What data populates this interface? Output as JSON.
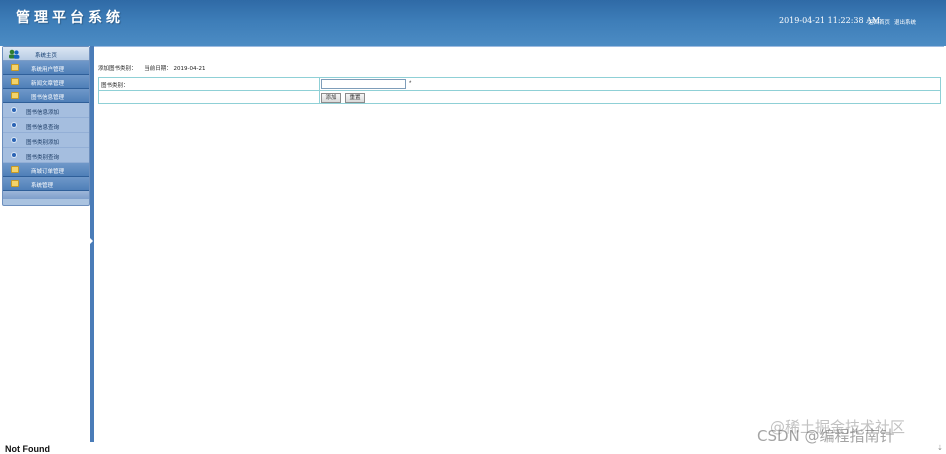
{
  "header": {
    "title": "管理平台系统",
    "datetime": "2019-04-21 11:22:38 AM",
    "home_link": "返回首页",
    "logout_link": "退出系统"
  },
  "sidebar": {
    "top_label": "系统主页",
    "menus": [
      {
        "label": "系统用户管理"
      },
      {
        "label": "新闻文章管理"
      },
      {
        "label": "图书信息管理"
      }
    ],
    "submenus": [
      {
        "label": "图书信息添加"
      },
      {
        "label": "图书信息查询"
      },
      {
        "label": "图书类别添加"
      },
      {
        "label": "图书类别查询"
      }
    ],
    "menus_after": [
      {
        "label": "商城订单管理"
      },
      {
        "label": "系统管理"
      }
    ]
  },
  "main": {
    "crumb_prefix": "添加图书类别：",
    "crumb_date_label": "当前日期：",
    "crumb_date": "2019-04-21",
    "field_label": "图书类别：",
    "field_value": "",
    "required_mark": "*",
    "add_button": "添加",
    "reset_button": "重置"
  },
  "footer": {
    "status_text": "Not Found",
    "scroll_glyph": "⇣"
  },
  "watermark": {
    "line1": "@稀土掘金技术社区",
    "line2": "CSDN @编程指南针"
  }
}
